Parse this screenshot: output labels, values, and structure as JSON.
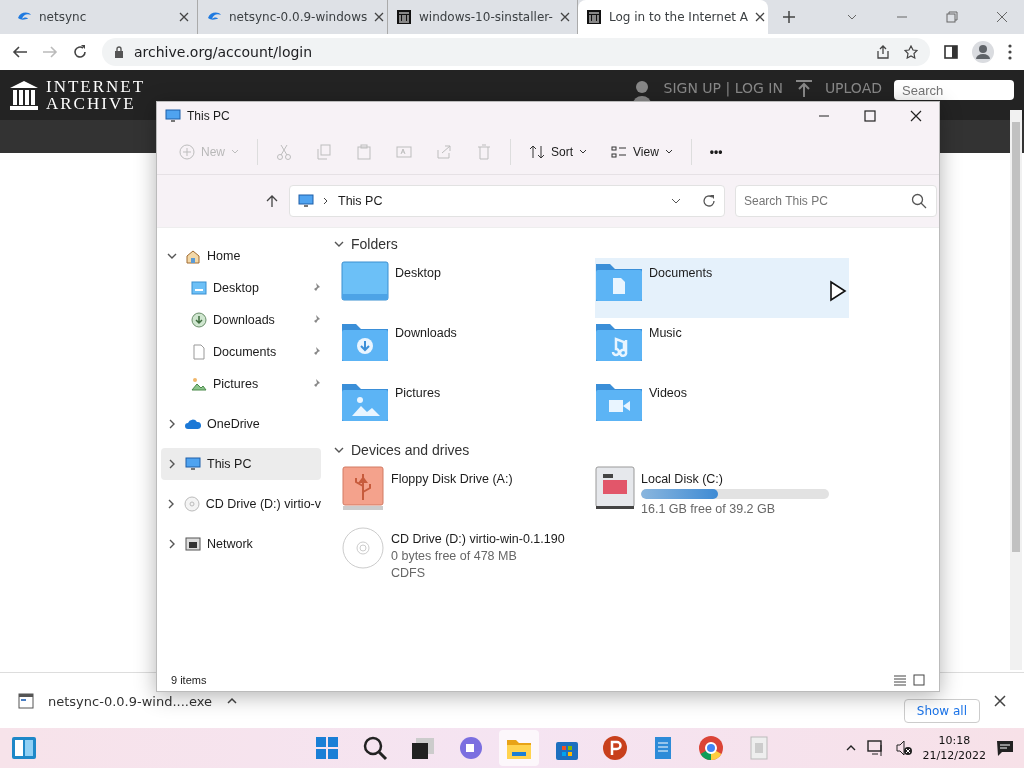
{
  "browser": {
    "tabs": [
      {
        "title": "netsync",
        "kind": "netsync",
        "selected": false
      },
      {
        "title": "netsync-0.0.9-windows",
        "kind": "netsync",
        "selected": false
      },
      {
        "title": "windows-10-sinstaller-",
        "kind": "archive",
        "selected": false
      },
      {
        "title": "Log in to the Internet A",
        "kind": "archive",
        "selected": true
      }
    ],
    "url": "archive.org/account/login",
    "site": {
      "logo_lines": [
        "INTERNET",
        "ARCHIVE"
      ],
      "account_link": "SIGN UP | LOG IN",
      "upload": "UPLOAD",
      "search_placeholder": "Search"
    },
    "download_bar": {
      "file": "netsync-0.0.9-wind....exe",
      "show_all": "Show all"
    }
  },
  "explorer": {
    "title": "This PC",
    "toolbar": [
      {
        "kind": "new",
        "label": "New",
        "disabled": true
      },
      {
        "kind": "cut",
        "disabled": true
      },
      {
        "kind": "copy",
        "disabled": true
      },
      {
        "kind": "paste",
        "disabled": true
      },
      {
        "kind": "rename",
        "disabled": true
      },
      {
        "kind": "share",
        "disabled": true
      },
      {
        "kind": "delete",
        "disabled": true
      },
      {
        "kind": "sort",
        "label": "Sort",
        "disabled": false
      },
      {
        "kind": "view",
        "label": "View",
        "disabled": false
      },
      {
        "kind": "more",
        "label": "•••",
        "disabled": false
      }
    ],
    "breadcrumb": "This PC",
    "search_placeholder": "Search This PC",
    "nav": [
      {
        "label": "Home",
        "kind": "home",
        "expanded": true,
        "selected": false,
        "children": [
          {
            "label": "Desktop",
            "kind": "desktop",
            "pinned": true,
            "selected": false
          },
          {
            "label": "Downloads",
            "kind": "downloads",
            "pinned": true,
            "selected": false
          },
          {
            "label": "Documents",
            "kind": "documents",
            "pinned": true,
            "selected": false
          },
          {
            "label": "Pictures",
            "kind": "pictures",
            "pinned": true,
            "selected": false
          }
        ]
      },
      {
        "label": "OneDrive",
        "kind": "cloud",
        "expanded": false,
        "selected": false
      },
      {
        "label": "This PC",
        "kind": "pc",
        "expanded": false,
        "selected": true
      },
      {
        "label": "CD Drive (D:) virtio-v",
        "kind": "cd",
        "expanded": false,
        "selected": false
      },
      {
        "label": "Network",
        "kind": "network",
        "expanded": false,
        "selected": false
      }
    ],
    "sections": [
      {
        "title": "Folders",
        "kind": "folders",
        "items": [
          {
            "name": "Desktop",
            "kind": "desktop",
            "selected": false
          },
          {
            "name": "Documents",
            "kind": "documents",
            "selected": true
          },
          {
            "name": "Downloads",
            "kind": "downloads",
            "selected": false
          },
          {
            "name": "Music",
            "kind": "music",
            "selected": false
          },
          {
            "name": "Pictures",
            "kind": "pictures",
            "selected": false
          },
          {
            "name": "Videos",
            "kind": "videos",
            "selected": false
          }
        ]
      },
      {
        "title": "Devices and drives",
        "kind": "drives",
        "items": [
          {
            "name": "Floppy Disk Drive (A:)",
            "kind": "usb"
          },
          {
            "name": "Local Disk (C:)",
            "kind": "disk",
            "level": 0.41,
            "detail": "16.1 GB free of 39.2 GB"
          },
          {
            "name": "CD Drive (D:) virtio-win-0.1.190",
            "kind": "cd",
            "detail": "0 bytes free of 478 MB",
            "filesystem": "CDFS"
          }
        ]
      }
    ],
    "status": "9 items"
  },
  "taskbar": {
    "apps": [
      {
        "kind": "start",
        "active": false
      },
      {
        "kind": "search",
        "active": false
      },
      {
        "kind": "taskview",
        "active": false
      },
      {
        "kind": "chat",
        "active": false
      },
      {
        "kind": "explorer",
        "active": true
      },
      {
        "kind": "store",
        "active": false
      },
      {
        "kind": "p",
        "active": false
      },
      {
        "kind": "notepad",
        "active": false
      },
      {
        "kind": "chrome",
        "active": false
      },
      {
        "kind": "app",
        "active": false
      }
    ],
    "time": "10:18",
    "date": "21/12/2022"
  }
}
